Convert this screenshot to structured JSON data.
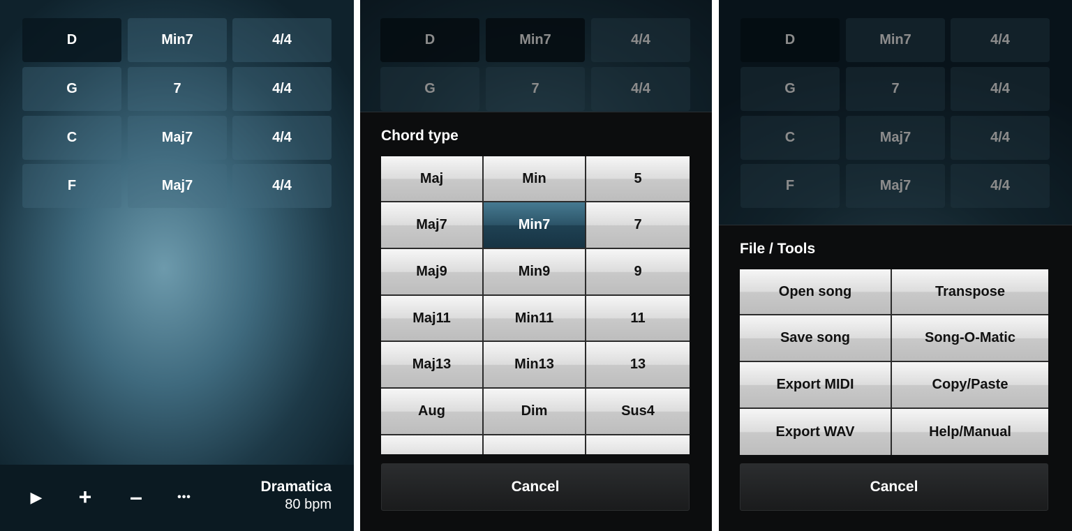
{
  "song_panel": {
    "rows": [
      {
        "root": "D",
        "type": "Min7",
        "meter": "4/4"
      },
      {
        "root": "G",
        "type": "7",
        "meter": "4/4"
      },
      {
        "root": "C",
        "type": "Maj7",
        "meter": "4/4"
      },
      {
        "root": "F",
        "type": "Maj7",
        "meter": "4/4"
      }
    ],
    "controls": {
      "play": "▶",
      "add": "+",
      "remove": "–",
      "more": "•••"
    },
    "song_name": "Dramatica",
    "tempo": "80 bpm"
  },
  "chord_type_panel": {
    "title": "Chord type",
    "options": [
      [
        "Maj",
        "Min",
        "5"
      ],
      [
        "Maj7",
        "Min7",
        "7"
      ],
      [
        "Maj9",
        "Min9",
        "9"
      ],
      [
        "Maj11",
        "Min11",
        "11"
      ],
      [
        "Maj13",
        "Min13",
        "13"
      ],
      [
        "Aug",
        "Dim",
        "Sus4"
      ]
    ],
    "selected": "Min7",
    "cancel_label": "Cancel"
  },
  "file_tools_panel": {
    "title": "File / Tools",
    "options": [
      [
        "Open song",
        "Transpose"
      ],
      [
        "Save song",
        "Song-O-Matic"
      ],
      [
        "Export MIDI",
        "Copy/Paste"
      ],
      [
        "Export WAV",
        "Help/Manual"
      ]
    ],
    "cancel_label": "Cancel"
  },
  "colors": {
    "accent_blue": "#2c5468",
    "background_dark": "#0c0d0e",
    "button_light": "#dcdcdc"
  }
}
